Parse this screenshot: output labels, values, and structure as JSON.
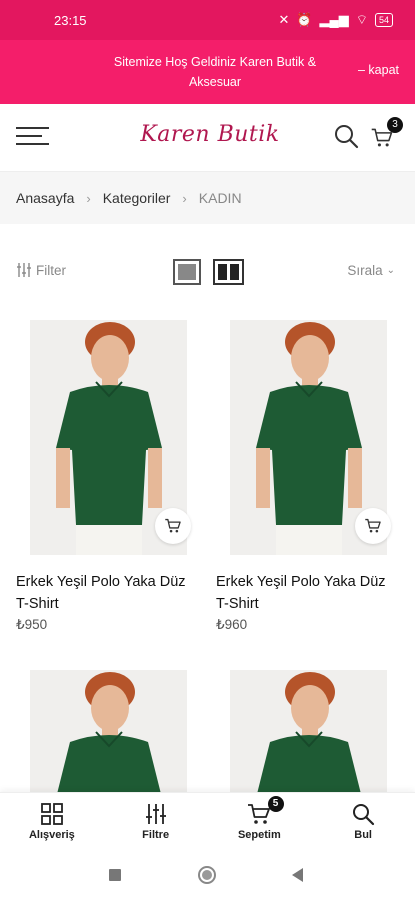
{
  "status_bar": {
    "time": "23:15",
    "battery": "54"
  },
  "promo": {
    "message": "Sitemize Hoş Geldiniz Karen Butik & Aksesuar",
    "close_label": "– kapat"
  },
  "header": {
    "logo": "Karen Butik",
    "cart_count": "3"
  },
  "breadcrumb": {
    "items": [
      "Anasayfa",
      "Kategoriler",
      "KADIN"
    ]
  },
  "toolbar": {
    "filter_label": "Filter",
    "sort_label": "Sırala"
  },
  "products": [
    {
      "name": "Erkek Yeşil Polo Yaka Düz T-Shirt",
      "price": "₺950"
    },
    {
      "name": "Erkek Yeşil Polo Yaka Düz T-Shirt",
      "price": "₺960"
    },
    {
      "name": "",
      "price": ""
    },
    {
      "name": "",
      "price": ""
    }
  ],
  "bottom_nav": {
    "items": [
      "Alışveriş",
      "Filtre",
      "Sepetim",
      "Bul"
    ],
    "cart_badge": "5"
  },
  "colors": {
    "brand": "#f41e6a",
    "status_bar": "#e3175f",
    "logo": "#b0174f",
    "shirt": "#1e5b34"
  }
}
